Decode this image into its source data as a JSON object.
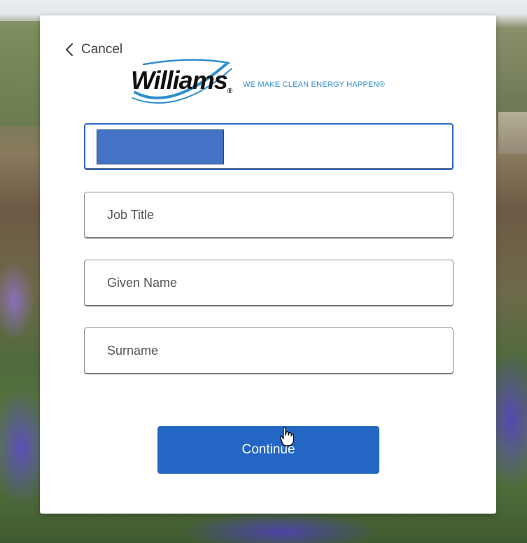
{
  "nav": {
    "cancel_label": "Cancel"
  },
  "brand": {
    "name": "Williams",
    "registered_mark": "®",
    "tagline": "WE MAKE CLEAN ENERGY HAPPEN®",
    "swoosh_color": "#2f8fcf"
  },
  "form": {
    "fields": [
      {
        "placeholder": "",
        "redacted": true
      },
      {
        "placeholder": "Job Title"
      },
      {
        "placeholder": "Given Name"
      },
      {
        "placeholder": "Surname"
      }
    ],
    "submit_label": "Continue"
  },
  "colors": {
    "accent": "#2466c4",
    "focus_border": "#2b6cc4",
    "redaction": "#4472c4"
  }
}
